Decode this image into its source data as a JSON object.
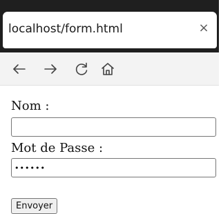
{
  "browser": {
    "tab_title": "localhost/form.html",
    "tab_close": "×"
  },
  "nav": {
    "back_icon": "arrow-left-icon",
    "forward_icon": "arrow-right-icon",
    "reload_icon": "reload-icon",
    "home_icon": "home-icon"
  },
  "form": {
    "name_label": "Nom :",
    "name_value": "",
    "password_label": "Mot de Passe :",
    "password_value": "••••••",
    "submit_label": "Envoyer"
  }
}
